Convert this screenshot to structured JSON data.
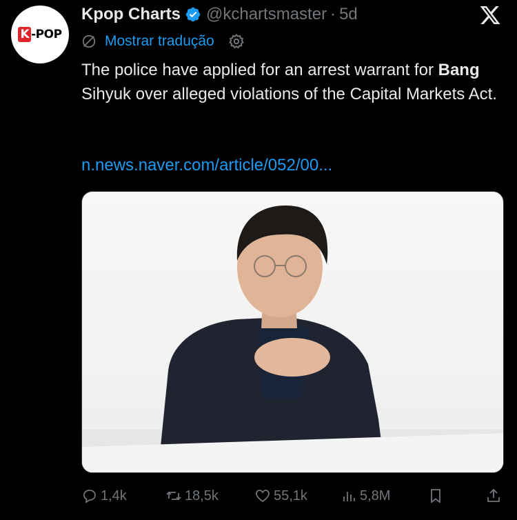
{
  "avatar": {
    "logo_text_k": "K",
    "logo_text_rest": "-POP"
  },
  "tweet": {
    "author_name": "Kpop Charts",
    "handle": "@kchartsmaster",
    "separator": "·",
    "time": "5d",
    "translate_label": "Mostrar tradução",
    "text_part1": "The police have applied for an arrest warrant for ",
    "text_bold": "Bang",
    "text_part2": " Sihyuk over alleged violations of the Capital Markets Act.",
    "link": "n.news.naver.com/article/052/00...",
    "image_icon": "portrait-photo"
  },
  "actions": {
    "replies": "1,4k",
    "reposts": "18,5k",
    "likes": "55,1k",
    "views": "5,8M"
  },
  "colors": {
    "background": "#000000",
    "text": "#e7e9ea",
    "secondary": "#71767b",
    "accent": "#1d9bf0",
    "verified": "#1d9bf0"
  }
}
